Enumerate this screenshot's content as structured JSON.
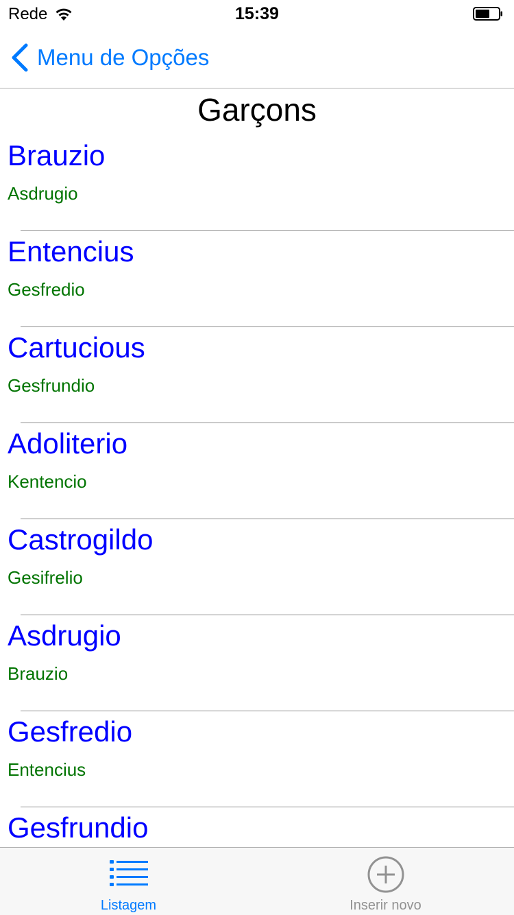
{
  "status_bar": {
    "carrier": "Rede",
    "time": "15:39",
    "icons": [
      "wifi-icon",
      "battery-icon"
    ]
  },
  "nav": {
    "back_label": "Menu de Opções",
    "back_icon": "chevron-left-icon"
  },
  "page": {
    "title": "Garçons"
  },
  "list": {
    "items": [
      {
        "title": "Brauzio",
        "subtitle": "Asdrugio"
      },
      {
        "title": "Entencius",
        "subtitle": "Gesfredio"
      },
      {
        "title": "Cartucious",
        "subtitle": "Gesfrundio"
      },
      {
        "title": "Adoliterio",
        "subtitle": "Kentencio"
      },
      {
        "title": "Castrogildo",
        "subtitle": "Gesifrelio"
      },
      {
        "title": "Asdrugio",
        "subtitle": "Brauzio"
      },
      {
        "title": "Gesfredio",
        "subtitle": "Entencius"
      },
      {
        "title": "Gesfrundio",
        "subtitle": ""
      }
    ]
  },
  "tabs": [
    {
      "label": "Listagem",
      "icon": "list-icon",
      "active": true
    },
    {
      "label": "Inserir novo",
      "icon": "add-circle-icon",
      "active": false
    }
  ],
  "colors": {
    "accent": "#007aff",
    "item_title": "#0000ff",
    "item_subtitle": "#007400",
    "tab_inactive": "#929292"
  }
}
